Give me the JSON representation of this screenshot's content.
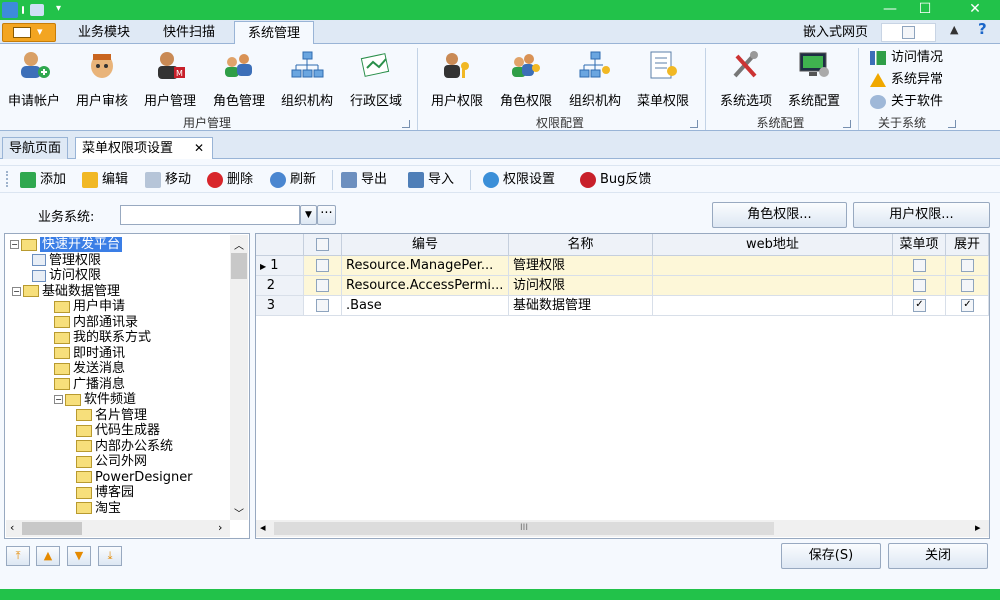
{
  "ribbon_tabs": [
    "业务模块",
    "快件扫描",
    "系统管理"
  ],
  "embed_label": "嵌入式网页",
  "ribbon": {
    "user_group": {
      "label": "用户管理",
      "items": [
        "申请帐户",
        "用户审核",
        "用户管理",
        "角色管理",
        "组织机构",
        "行政区域"
      ]
    },
    "perm_group": {
      "label": "权限配置",
      "items": [
        "用户权限",
        "角色权限",
        "组织机构",
        "菜单权限"
      ]
    },
    "config_group": {
      "label": "系统配置",
      "items": [
        "系统选项",
        "系统配置"
      ]
    },
    "about_group": {
      "label": "关于系统",
      "items": [
        "访问情况",
        "系统异常",
        "关于软件"
      ]
    }
  },
  "doc_tabs": [
    "导航页面",
    "菜单权限项设置"
  ],
  "toolbar": [
    "添加",
    "编辑",
    "移动",
    "删除",
    "刷新",
    "导出",
    "导入",
    "权限设置",
    "Bug反馈"
  ],
  "filter": {
    "label": "业务系统:",
    "value": ""
  },
  "buttons": {
    "role_perm": "角色权限...",
    "user_perm": "用户权限...",
    "save": "保存(S)",
    "close": "关闭"
  },
  "tree": {
    "root": "快速开发平台",
    "nodes": [
      {
        "label": "管理权限",
        "level": 1,
        "kind": "doc"
      },
      {
        "label": "访问权限",
        "level": 1,
        "kind": "doc"
      },
      {
        "label": "基础数据管理",
        "level": 1,
        "kind": "folder"
      },
      {
        "label": "用户申请",
        "level": 2,
        "kind": "folder"
      },
      {
        "label": "内部通讯录",
        "level": 2,
        "kind": "folder"
      },
      {
        "label": "我的联系方式",
        "level": 2,
        "kind": "folder"
      },
      {
        "label": "即时通讯",
        "level": 2,
        "kind": "folder"
      },
      {
        "label": "发送消息",
        "level": 2,
        "kind": "folder"
      },
      {
        "label": "广播消息",
        "level": 2,
        "kind": "folder"
      },
      {
        "label": "软件频道",
        "level": 2,
        "kind": "folder"
      },
      {
        "label": "名片管理",
        "level": 3,
        "kind": "folder"
      },
      {
        "label": "代码生成器",
        "level": 3,
        "kind": "folder"
      },
      {
        "label": "内部办公系统",
        "level": 3,
        "kind": "folder"
      },
      {
        "label": "公司外网",
        "level": 3,
        "kind": "folder"
      },
      {
        "label": "PowerDesigner",
        "level": 3,
        "kind": "folder"
      },
      {
        "label": "博客园",
        "level": 3,
        "kind": "folder"
      },
      {
        "label": "淘宝",
        "level": 3,
        "kind": "folder"
      }
    ]
  },
  "grid": {
    "columns": [
      "编号",
      "名称",
      "web地址",
      "菜单项",
      "展开"
    ],
    "rows": [
      {
        "num": "1",
        "code": "Resource.ManagePer...",
        "name": "管理权限",
        "web": "",
        "menu": false,
        "expand": false
      },
      {
        "num": "2",
        "code": "Resource.AccessPermi...",
        "name": "访问权限",
        "web": "",
        "menu": false,
        "expand": false
      },
      {
        "num": "3",
        "code": ".Base",
        "name": "基础数据管理",
        "web": "",
        "menu": true,
        "expand": true
      }
    ]
  },
  "colors": {
    "titlebar": "#22c24a",
    "ribbon_bg": "#f5f9fe",
    "tab_bg": "#dfe9f5",
    "selected": "#3a7ee6",
    "row_highlight": "#fdf7d8"
  }
}
